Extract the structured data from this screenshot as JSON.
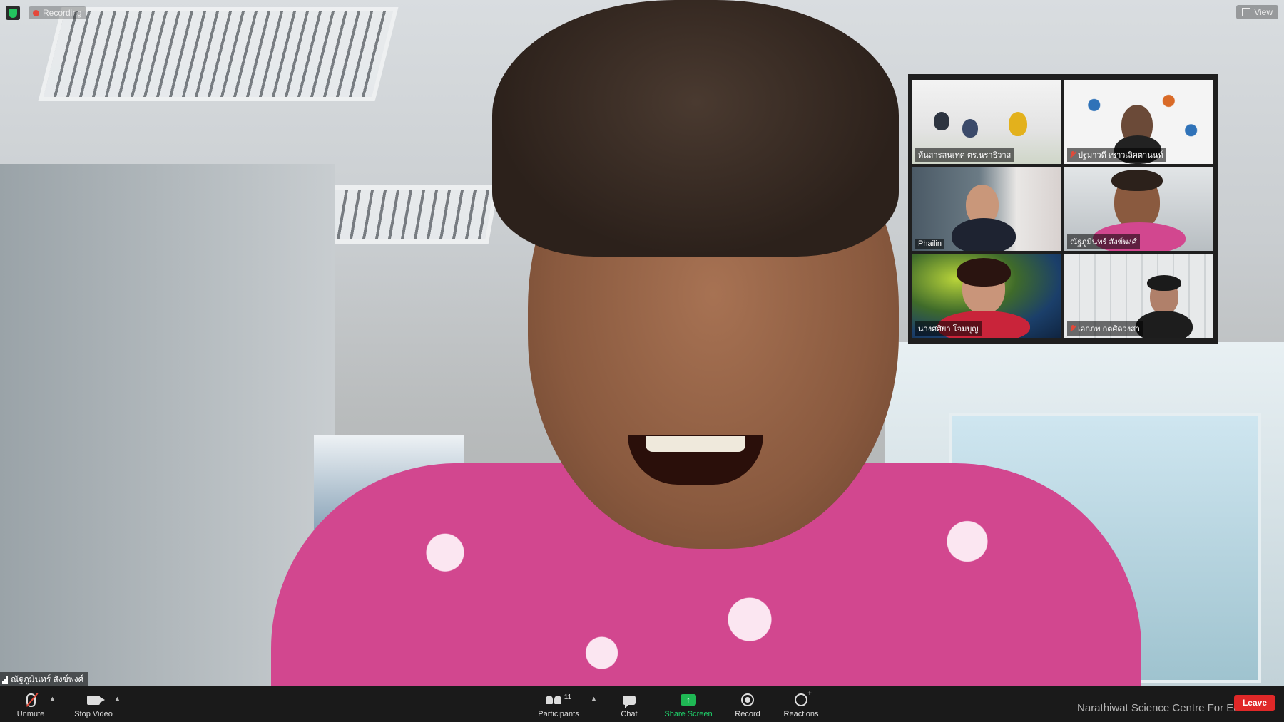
{
  "status": {
    "recording_label": "Recording"
  },
  "header": {
    "view_label": "View"
  },
  "gallery": {
    "tiles": [
      {
        "name": "ห้นสารสนเทศ ตร.นราธิวาส",
        "muted": false
      },
      {
        "name": "ปฐมาวดี เชาวเลิศตานนท์",
        "muted": true
      },
      {
        "name": "Phailin",
        "muted": false
      },
      {
        "name": "ณัฐภูมินทร์ สังข์พงศ์",
        "muted": false,
        "active": true
      },
      {
        "name": "นางศศิยา โจมบุญ",
        "muted": false
      },
      {
        "name": "เอกภพ กตศิดวงสา",
        "muted": true
      }
    ]
  },
  "self": {
    "name": "ณัฐภูมินทร์ สังข์พงศ์"
  },
  "toolbar": {
    "unmute_label": "Unmute",
    "stop_video_label": "Stop Video",
    "participants_label": "Participants",
    "participants_count": "11",
    "chat_label": "Chat",
    "share_label": "Share Screen",
    "record_label": "Record",
    "reactions_label": "Reactions",
    "leave_label": "Leave"
  },
  "watermark": {
    "text": "Narathiwat Science Centre For Education"
  }
}
